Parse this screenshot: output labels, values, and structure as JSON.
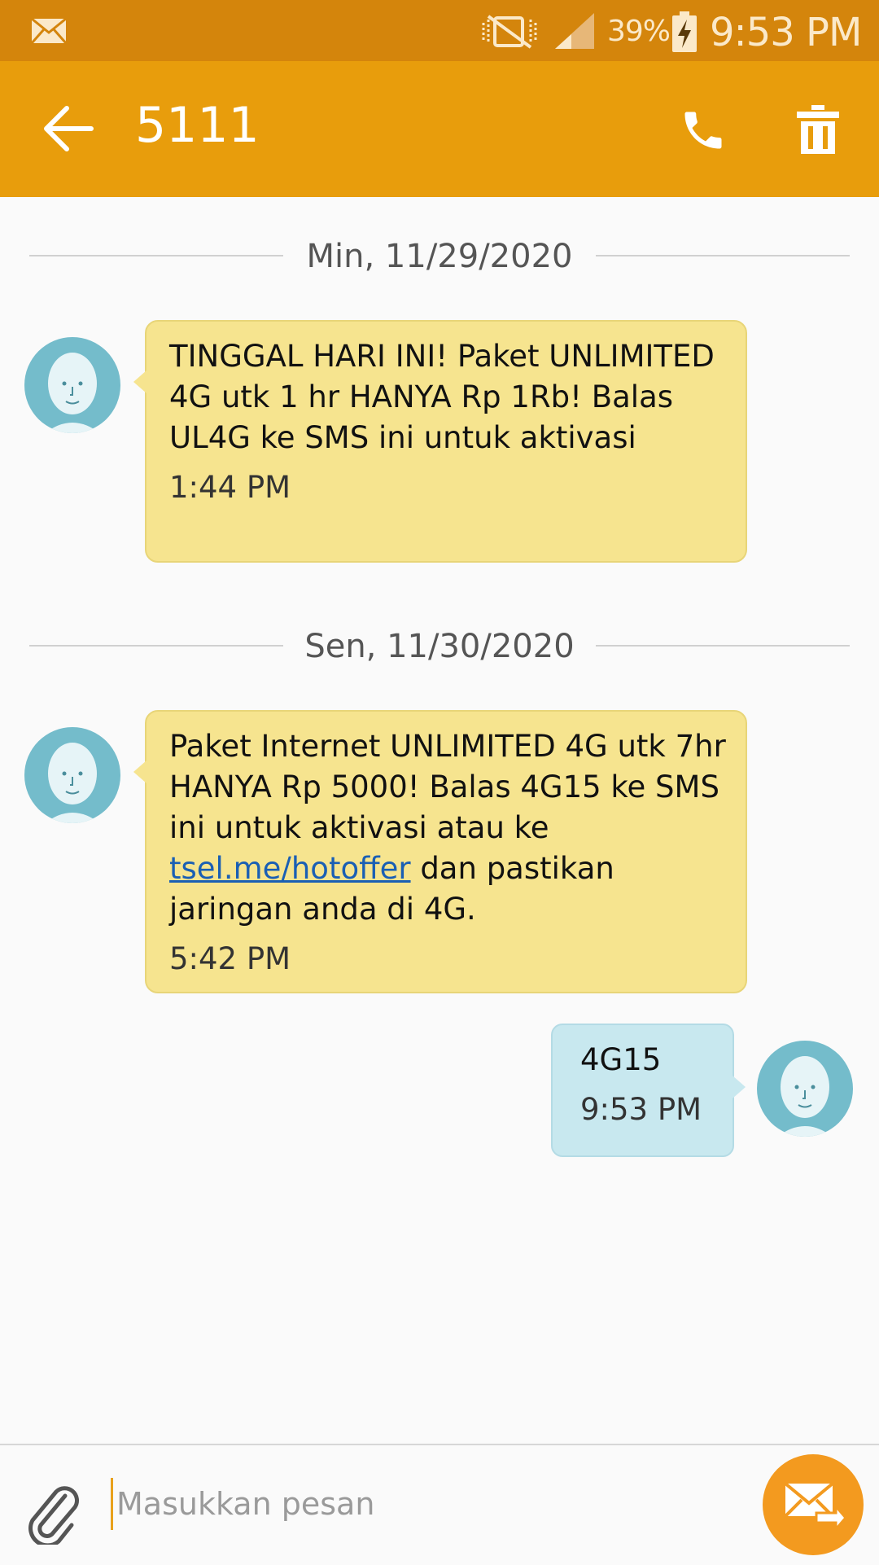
{
  "status_bar": {
    "battery_percent": "39%",
    "time": "9:53 PM",
    "icons": [
      "mail-icon",
      "mute-icon",
      "signal-icon",
      "battery-charging-icon"
    ]
  },
  "app_bar": {
    "title": "5111",
    "icons": [
      "back-arrow-icon",
      "phone-icon",
      "trash-icon"
    ]
  },
  "conversation": {
    "groups": [
      {
        "date": "Min, 11/29/2020",
        "messages": [
          {
            "direction": "incoming",
            "text": "TINGGAL HARI INI! Paket UNLIMITED 4G utk 1 hr HANYA Rp 1Rb! Balas UL4G ke SMS ini untuk aktivasi",
            "time": "1:44 PM"
          }
        ]
      },
      {
        "date": "Sen, 11/30/2020",
        "messages": [
          {
            "direction": "incoming",
            "text_before_link": "Paket Internet UNLIMITED 4G utk 7hr HANYA Rp 5000! Balas 4G15 ke SMS ini untuk aktivasi atau ke ",
            "link": "tsel.me/hotoffer",
            "text_after_link": " dan pastikan jaringan anda di 4G.",
            "time": "5:42 PM"
          },
          {
            "direction": "outgoing",
            "text": "4G15",
            "time": "9:53 PM"
          }
        ]
      }
    ]
  },
  "composer": {
    "placeholder": "Masukkan pesan",
    "value": "",
    "icons": [
      "paperclip-icon",
      "send-icon"
    ]
  },
  "colors": {
    "status_bar": "#d4850c",
    "app_bar": "#e89d0c",
    "incoming_bubble": "#f6e48f",
    "outgoing_bubble": "#c8e8ef",
    "send_button": "#f39a1f",
    "avatar": "#74bccb"
  }
}
